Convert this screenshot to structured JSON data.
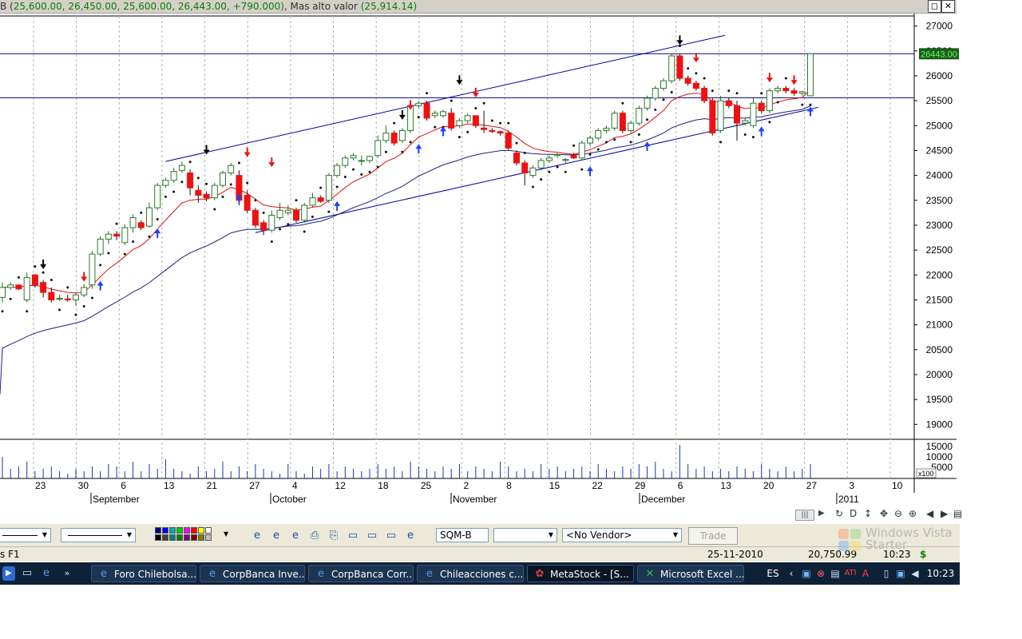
{
  "title_bar": {
    "prefix": "B (",
    "ohlc": "25,600.00, 26,450.00, 25,600.00, 26,443.00, +790.000)",
    "label": ", Mas  alto valor ",
    "value": "(25,914.14)",
    "restore_icon": "restore-icon",
    "close_icon": "close-icon",
    "restore_glyph": "◻",
    "close_glyph": "✕"
  },
  "chart_data": {
    "type": "candlestick",
    "title": "",
    "price_axis": {
      "ticks": [
        27000,
        26500,
        26000,
        25500,
        25000,
        24500,
        24000,
        23500,
        23000,
        22500,
        22000,
        21500,
        21000,
        20500,
        20000,
        19500,
        19000
      ],
      "range": [
        18700,
        27250
      ]
    },
    "last_price_label": "26443.00",
    "last_price": 26443,
    "horizontal_lines": [
      26443,
      25560
    ],
    "volume_axis": {
      "ticks": [
        "15000",
        "10000",
        "5000"
      ],
      "unit_label": "x100"
    },
    "date_axis": {
      "day_labels": [
        "23",
        "30",
        "6",
        "13",
        "21",
        "27",
        "4",
        "12",
        "18",
        "25",
        "2",
        "8",
        "15",
        "22",
        "29",
        "6",
        "13",
        "20",
        "27",
        "3",
        "10"
      ],
      "month_labels": [
        "September",
        "October",
        "November",
        "December",
        "2011"
      ]
    },
    "candles": [
      {
        "o": 21550,
        "h": 21850,
        "l": 21450,
        "c": 21750
      },
      {
        "o": 21750,
        "h": 21850,
        "l": 21700,
        "c": 21800
      },
      {
        "o": 21800,
        "h": 21800,
        "l": 21700,
        "c": 21720
      },
      {
        "o": 21500,
        "h": 22050,
        "l": 21450,
        "c": 21950
      },
      {
        "o": 22000,
        "h": 22020,
        "l": 21750,
        "c": 21800
      },
      {
        "o": 21850,
        "h": 21900,
        "l": 21550,
        "c": 21650
      },
      {
        "o": 21650,
        "h": 21750,
        "l": 21450,
        "c": 21500
      },
      {
        "o": 21520,
        "h": 21600,
        "l": 21480,
        "c": 21530
      },
      {
        "o": 21520,
        "h": 21600,
        "l": 21460,
        "c": 21500
      },
      {
        "o": 21500,
        "h": 21650,
        "l": 21380,
        "c": 21600
      },
      {
        "o": 21600,
        "h": 21820,
        "l": 21550,
        "c": 21750
      },
      {
        "o": 21800,
        "h": 22480,
        "l": 21720,
        "c": 22420
      },
      {
        "o": 22420,
        "h": 22780,
        "l": 22380,
        "c": 22720
      },
      {
        "o": 22720,
        "h": 22880,
        "l": 22620,
        "c": 22820
      },
      {
        "o": 22820,
        "h": 22880,
        "l": 22700,
        "c": 22780
      },
      {
        "o": 22650,
        "h": 23020,
        "l": 22600,
        "c": 22950
      },
      {
        "o": 22950,
        "h": 23220,
        "l": 22850,
        "c": 23150
      },
      {
        "o": 23050,
        "h": 23100,
        "l": 22900,
        "c": 22950
      },
      {
        "o": 22980,
        "h": 23450,
        "l": 22950,
        "c": 23350
      },
      {
        "o": 23350,
        "h": 23850,
        "l": 23300,
        "c": 23800
      },
      {
        "o": 23800,
        "h": 23950,
        "l": 23750,
        "c": 23900
      },
      {
        "o": 23900,
        "h": 24150,
        "l": 23850,
        "c": 24080
      },
      {
        "o": 24100,
        "h": 24280,
        "l": 24050,
        "c": 24200
      },
      {
        "o": 24050,
        "h": 24120,
        "l": 23600,
        "c": 23750
      },
      {
        "o": 23700,
        "h": 23800,
        "l": 23450,
        "c": 23600
      },
      {
        "o": 23620,
        "h": 23680,
        "l": 23480,
        "c": 23550
      },
      {
        "o": 23550,
        "h": 23850,
        "l": 23500,
        "c": 23800
      },
      {
        "o": 23800,
        "h": 24100,
        "l": 23750,
        "c": 24050
      },
      {
        "o": 24050,
        "h": 24250,
        "l": 24000,
        "c": 24200
      },
      {
        "o": 24000,
        "h": 24100,
        "l": 23400,
        "c": 23500
      },
      {
        "o": 23600,
        "h": 23700,
        "l": 23250,
        "c": 23300
      },
      {
        "o": 23300,
        "h": 23350,
        "l": 22950,
        "c": 23000
      },
      {
        "o": 23050,
        "h": 23100,
        "l": 22800,
        "c": 22900
      },
      {
        "o": 22900,
        "h": 23300,
        "l": 22850,
        "c": 23200
      },
      {
        "o": 23150,
        "h": 23450,
        "l": 23100,
        "c": 23300
      },
      {
        "o": 23250,
        "h": 23400,
        "l": 23200,
        "c": 23300
      },
      {
        "o": 23300,
        "h": 23350,
        "l": 23050,
        "c": 23100
      },
      {
        "o": 23100,
        "h": 23450,
        "l": 23050,
        "c": 23400
      },
      {
        "o": 23400,
        "h": 23650,
        "l": 23350,
        "c": 23550
      },
      {
        "o": 23550,
        "h": 23600,
        "l": 23450,
        "c": 23480
      },
      {
        "o": 23500,
        "h": 24050,
        "l": 23450,
        "c": 24000
      },
      {
        "o": 24000,
        "h": 24250,
        "l": 23950,
        "c": 24200
      },
      {
        "o": 24200,
        "h": 24400,
        "l": 24150,
        "c": 24350
      },
      {
        "o": 24350,
        "h": 24450,
        "l": 24300,
        "c": 24400
      },
      {
        "o": 24300,
        "h": 24400,
        "l": 24200,
        "c": 24300
      },
      {
        "o": 24300,
        "h": 24400,
        "l": 24250,
        "c": 24380
      },
      {
        "o": 24400,
        "h": 24800,
        "l": 24350,
        "c": 24700
      },
      {
        "o": 24700,
        "h": 25000,
        "l": 24650,
        "c": 24850
      },
      {
        "o": 24850,
        "h": 24900,
        "l": 24600,
        "c": 24650
      },
      {
        "o": 24700,
        "h": 24950,
        "l": 24650,
        "c": 24900
      },
      {
        "o": 24900,
        "h": 25450,
        "l": 24850,
        "c": 25400
      },
      {
        "o": 25400,
        "h": 25500,
        "l": 25350,
        "c": 25450
      },
      {
        "o": 25450,
        "h": 25500,
        "l": 25100,
        "c": 25150
      },
      {
        "o": 25200,
        "h": 25300,
        "l": 25150,
        "c": 25250
      },
      {
        "o": 25200,
        "h": 25320,
        "l": 25150,
        "c": 25280
      },
      {
        "o": 25250,
        "h": 25350,
        "l": 24900,
        "c": 24950
      },
      {
        "o": 25000,
        "h": 25150,
        "l": 24950,
        "c": 25100
      },
      {
        "o": 25100,
        "h": 25250,
        "l": 25050,
        "c": 25200
      },
      {
        "o": 25200,
        "h": 25200,
        "l": 24950,
        "c": 25000
      },
      {
        "o": 24950,
        "h": 25300,
        "l": 24850,
        "c": 24920
      },
      {
        "o": 24900,
        "h": 24950,
        "l": 24850,
        "c": 24880
      },
      {
        "o": 24880,
        "h": 24900,
        "l": 24800,
        "c": 24850
      },
      {
        "o": 24850,
        "h": 24900,
        "l": 24500,
        "c": 24550
      },
      {
        "o": 24450,
        "h": 24500,
        "l": 24200,
        "c": 24250
      },
      {
        "o": 24250,
        "h": 24300,
        "l": 23800,
        "c": 24050
      },
      {
        "o": 24000,
        "h": 24200,
        "l": 23950,
        "c": 24150
      },
      {
        "o": 24150,
        "h": 24350,
        "l": 24100,
        "c": 24300
      },
      {
        "o": 24300,
        "h": 24400,
        "l": 24250,
        "c": 24350
      },
      {
        "o": 24400,
        "h": 24450,
        "l": 24350,
        "c": 24420
      },
      {
        "o": 24300,
        "h": 24350,
        "l": 24250,
        "c": 24320
      },
      {
        "o": 24400,
        "h": 24450,
        "l": 24330,
        "c": 24350
      },
      {
        "o": 24350,
        "h": 24700,
        "l": 24300,
        "c": 24650
      },
      {
        "o": 24650,
        "h": 24800,
        "l": 24600,
        "c": 24750
      },
      {
        "o": 24750,
        "h": 24950,
        "l": 24700,
        "c": 24900
      },
      {
        "o": 24900,
        "h": 25000,
        "l": 24850,
        "c": 24950
      },
      {
        "o": 24950,
        "h": 25300,
        "l": 24900,
        "c": 25250
      },
      {
        "o": 25250,
        "h": 25300,
        "l": 24850,
        "c": 24900
      },
      {
        "o": 24900,
        "h": 25100,
        "l": 24850,
        "c": 25050
      },
      {
        "o": 25050,
        "h": 25400,
        "l": 25000,
        "c": 25350
      },
      {
        "o": 25350,
        "h": 25600,
        "l": 25300,
        "c": 25550
      },
      {
        "o": 25550,
        "h": 25800,
        "l": 25500,
        "c": 25750
      },
      {
        "o": 25750,
        "h": 25950,
        "l": 25700,
        "c": 25900
      },
      {
        "o": 25900,
        "h": 26450,
        "l": 25850,
        "c": 26400
      },
      {
        "o": 26400,
        "h": 26450,
        "l": 25900,
        "c": 25950
      },
      {
        "o": 25950,
        "h": 26000,
        "l": 25800,
        "c": 25850
      },
      {
        "o": 25850,
        "h": 25900,
        "l": 25700,
        "c": 25750
      },
      {
        "o": 25750,
        "h": 25800,
        "l": 25450,
        "c": 25500
      },
      {
        "o": 25500,
        "h": 25550,
        "l": 24800,
        "c": 24850
      },
      {
        "o": 24900,
        "h": 25600,
        "l": 24850,
        "c": 25500
      },
      {
        "o": 25500,
        "h": 25550,
        "l": 25350,
        "c": 25400
      },
      {
        "o": 25400,
        "h": 25500,
        "l": 24700,
        "c": 25050
      },
      {
        "o": 25050,
        "h": 25150,
        "l": 25000,
        "c": 25100
      },
      {
        "o": 25000,
        "h": 25550,
        "l": 24950,
        "c": 25450
      },
      {
        "o": 25450,
        "h": 25500,
        "l": 25250,
        "c": 25300
      },
      {
        "o": 25300,
        "h": 25750,
        "l": 25250,
        "c": 25700
      },
      {
        "o": 25700,
        "h": 25800,
        "l": 25650,
        "c": 25750
      },
      {
        "o": 25750,
        "h": 25800,
        "l": 25650,
        "c": 25700
      },
      {
        "o": 25700,
        "h": 25750,
        "l": 25600,
        "c": 25650
      },
      {
        "o": 25650,
        "h": 25700,
        "l": 25600,
        "c": 25680
      },
      {
        "o": 25600,
        "h": 26450,
        "l": 25600,
        "c": 26443
      }
    ],
    "volumes": [
      9,
      4,
      5,
      7,
      3,
      4,
      5,
      3,
      2,
      4,
      3,
      5,
      3,
      6,
      5,
      3,
      7,
      3,
      6,
      4,
      8,
      4,
      3,
      2,
      5,
      3,
      4,
      7,
      3,
      5,
      3,
      6,
      4,
      3,
      2,
      6,
      3,
      2,
      5,
      4,
      6,
      3,
      5,
      4,
      3,
      4,
      6,
      4,
      5,
      3,
      7,
      5,
      4,
      3,
      5,
      4,
      6,
      3,
      5,
      4,
      3,
      7,
      5,
      3,
      4,
      3,
      6,
      4,
      5,
      3,
      4,
      5,
      3,
      6,
      4,
      3,
      5,
      4,
      6,
      5,
      7,
      4,
      3,
      14,
      6,
      4,
      5,
      3,
      4,
      3,
      5,
      4,
      3,
      6,
      4,
      3,
      5,
      3,
      4,
      6
    ]
  },
  "toolbar": {
    "symbol_value": "SQM-B",
    "vendor_value": "<No Vendor>",
    "trade_label": "Trade",
    "scroll_icons": [
      "scroll-left-icon",
      "scroll-right-icon"
    ]
  },
  "status_bar": {
    "left_text": "s F1",
    "date": "25-11-2010",
    "value": "20,750.99",
    "time": "10:23",
    "currency_symbol": "$"
  },
  "watermark": {
    "line1": "Windows Vista",
    "line2": "Starter"
  },
  "taskbar": {
    "buttons": [
      {
        "label": "Foro Chilebolsa...",
        "icon": "ie-icon"
      },
      {
        "label": "CorpBanca Inve...",
        "icon": "ie-icon"
      },
      {
        "label": "CorpBanca Corr...",
        "icon": "ie-icon"
      },
      {
        "label": "Chileacciones c...",
        "icon": "ie-icon"
      },
      {
        "label": "MetaStock - [S...",
        "icon": "metastock-icon"
      },
      {
        "label": "Microsoft Excel ...",
        "icon": "excel-icon"
      }
    ],
    "language": "ES",
    "clock": "10:23"
  },
  "colors": {
    "bull_candle": "#2a7a2a",
    "bear_candle": "#ee1111",
    "moving_average_short": "#dd1111",
    "moving_average_long": "#1a237e",
    "trend_line": "#0000aa",
    "last_price_bg": "#1a5e1a",
    "last_price_fg": "#66ff66",
    "stops_dots": "#111111",
    "buy_arrow": "#1e40ff",
    "sell_arrow_red": "#ee1111",
    "sell_arrow_black": "#000000",
    "volume_bar": "#2233aa"
  }
}
